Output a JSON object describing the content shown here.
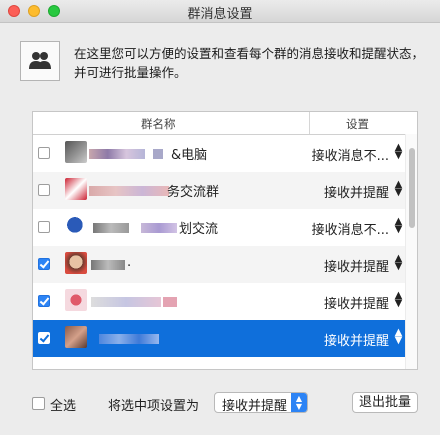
{
  "window": {
    "title": "群消息设置"
  },
  "header": {
    "description": "在这里您可以方便的设置和查看每个群的消息接收和提醒状态，并可进行批量操作。"
  },
  "table": {
    "columns": {
      "name": "群名称",
      "setting": "设置"
    },
    "rows": [
      {
        "name_visible": "&电脑",
        "setting": "接收消息不...",
        "checked": false,
        "selected": false
      },
      {
        "name_visible": "务交流群",
        "setting": "接收并提醒",
        "checked": false,
        "selected": false
      },
      {
        "name_visible": "划交流",
        "setting": "接收消息不...",
        "checked": false,
        "selected": false
      },
      {
        "name_visible": ".",
        "setting": "接收并提醒",
        "checked": true,
        "selected": false
      },
      {
        "name_visible": "",
        "setting": "接收并提醒",
        "checked": true,
        "selected": false
      },
      {
        "name_visible": "",
        "setting": "接收并提醒",
        "checked": true,
        "selected": true
      }
    ],
    "up_arrow": "▲",
    "down_arrow": "▼"
  },
  "footer": {
    "select_all": "全选",
    "set_selected_as": "将选中项设置为",
    "popup_value": "接收并提醒",
    "exit_batch_button": "退出批量"
  },
  "colors": {
    "selection": "#0f6fdb",
    "checkbox_checked": "#2d84f5"
  }
}
